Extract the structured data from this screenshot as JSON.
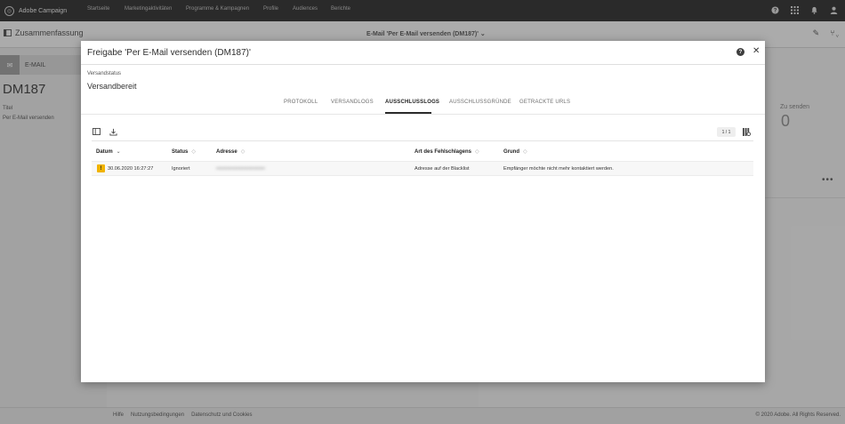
{
  "app": {
    "brand": "Adobe Campaign",
    "nav": [
      "Startseite",
      "Marketingaktivitäten",
      "Programme & Kampagnen",
      "Profile",
      "Audiences",
      "Berichte"
    ]
  },
  "subbar": {
    "summary": "Zusammenfassung",
    "center_title": "E-Mail 'Per E-Mail versenden (DM187)'"
  },
  "background": {
    "email_tab": "E-MAIL",
    "dm_code": "DM187",
    "titel_label": "Titel",
    "titel_value": "Per E-Mail versenden",
    "zu_senden_label": "Zu senden",
    "zu_senden_value": "0"
  },
  "footer": {
    "links": [
      "Hilfe",
      "Nutzungsbedingungen",
      "Datenschutz und Cookies"
    ],
    "copyright": "© 2020 Adobe. All Rights Reserved."
  },
  "modal": {
    "title": "Freigabe 'Per E-Mail versenden (DM187)'",
    "status_label": "Versandstatus",
    "status_value": "Versandbereit",
    "tabs": [
      "PROTOKOLL",
      "VERSANDLOGS",
      "AUSSCHLUSSLOGS",
      "AUSSCHLUSSGRÜNDE",
      "GETRACKTE URLS"
    ],
    "active_tab": "AUSSCHLUSSLOGS",
    "pager": "1 / 1",
    "columns": [
      "Datum",
      "Status",
      "Adresse",
      "Art des Fehlschlagens",
      "Grund"
    ],
    "rows": [
      {
        "datum": "30.06.2020 16:27:27",
        "status": "Ignoriert",
        "adresse": "••••••••••••••••••••••••••••",
        "art": "Adresse auf der Blacklist",
        "grund": "Empfänger möchte nicht mehr kontaktiert werden."
      }
    ]
  }
}
